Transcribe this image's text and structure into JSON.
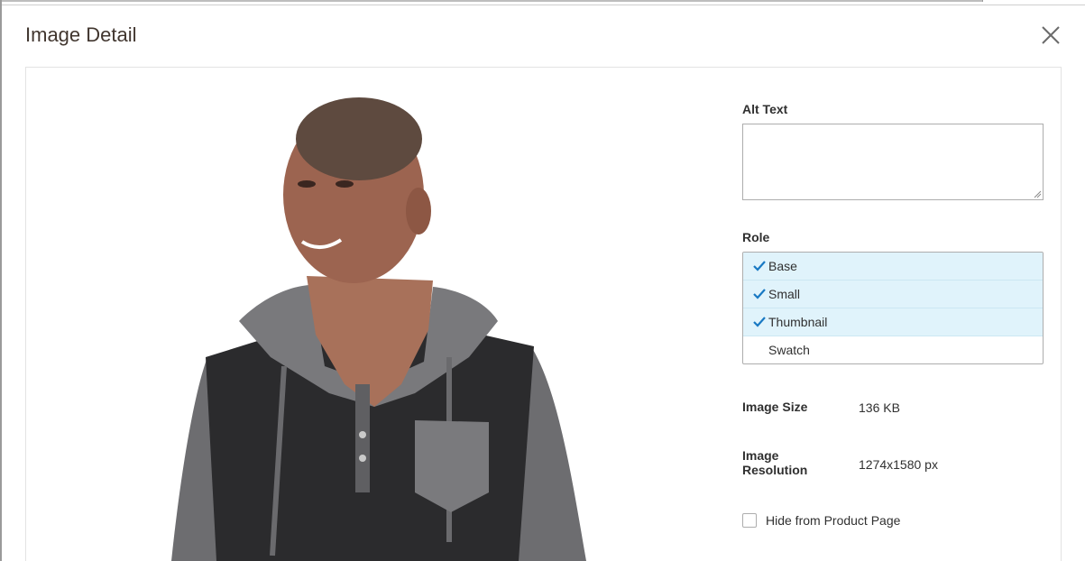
{
  "modal": {
    "title": "Image Detail",
    "close_icon": "close-x-icon"
  },
  "form": {
    "alt_text": {
      "label": "Alt Text",
      "value": ""
    },
    "role": {
      "label": "Role",
      "items": [
        {
          "label": "Base",
          "selected": true
        },
        {
          "label": "Small",
          "selected": true
        },
        {
          "label": "Thumbnail",
          "selected": true
        },
        {
          "label": "Swatch",
          "selected": false
        }
      ]
    },
    "image_size": {
      "label": "Image Size",
      "value": "136 KB"
    },
    "image_resolution": {
      "label_line1": "Image",
      "label_line2": "Resolution",
      "value": "1274x1580 px"
    },
    "hide_from_product_page": {
      "label": "Hide from Product Page",
      "checked": false
    }
  },
  "colors": {
    "selected_bg": "#e0f3fb",
    "check": "#1979c3",
    "title": "#41362f"
  }
}
